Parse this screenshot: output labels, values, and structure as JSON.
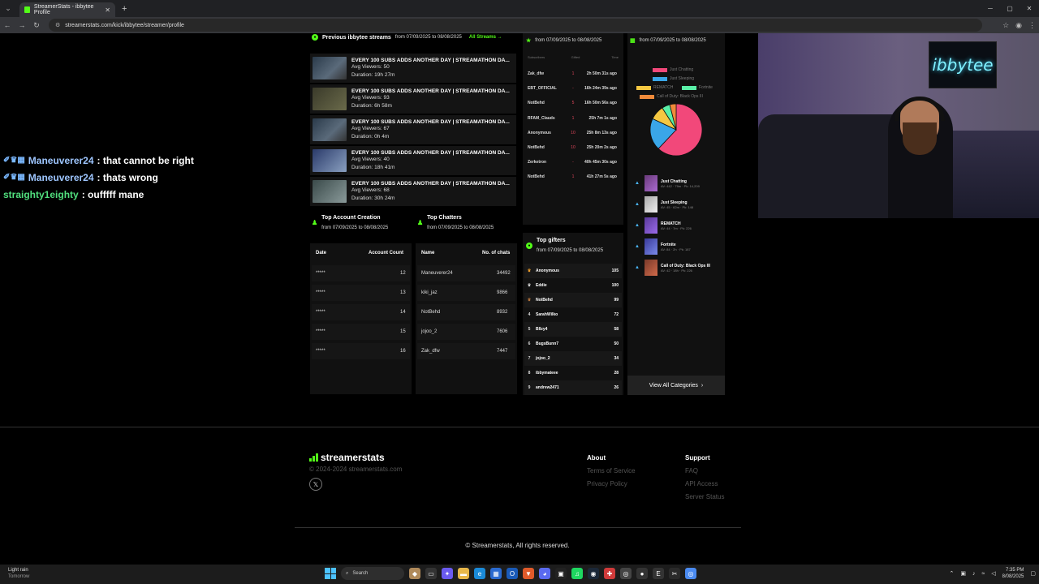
{
  "browser": {
    "tab_title": "StreamerStats - ibbytee Profile",
    "url": "streamerstats.com/kick/ibbytee/streamer/profile"
  },
  "chat": [
    {
      "user": "Maneuverer24",
      "message": ": that cannot be right"
    },
    {
      "user": "Maneuverer24",
      "message": ": thats wrong"
    },
    {
      "user": "straighty1eighty",
      "message": ": oufffff mane"
    }
  ],
  "webcam": {
    "neon_sign": "ibbytee"
  },
  "previous_streams": {
    "title": "Previous ibbytee streams",
    "date_range": "from 07/09/2025 to 08/08/2025",
    "all_link": "All Streams",
    "items": [
      {
        "title": "EVERY 100 SUBS ADDS ANOTHER DAY | STREAMATHON DA...",
        "viewers": "Avg Viewers: 50",
        "duration": "Duration: 19h 27m"
      },
      {
        "title": "EVERY 100 SUBS ADDS ANOTHER DAY | STREAMATHON DA...",
        "viewers": "Avg Viewers: 93",
        "duration": "Duration: 6h 58m"
      },
      {
        "title": "EVERY 100 SUBS ADDS ANOTHER DAY | STREAMATHON DA...",
        "viewers": "Avg Viewers: 67",
        "duration": "Duration: 0h 4m"
      },
      {
        "title": "EVERY 100 SUBS ADDS ANOTHER DAY | STREAMATHON DA...",
        "viewers": "Avg Viewers: 40",
        "duration": "Duration: 18h 41m"
      },
      {
        "title": "EVERY 100 SUBS ADDS ANOTHER DAY | STREAMATHON DA...",
        "viewers": "Avg Viewers: 68",
        "duration": "Duration: 30h 24m"
      }
    ]
  },
  "subs_panel": {
    "date_range": "from 07/09/2025 to 08/08/2025",
    "headers": [
      "Subscribers",
      "Gifted",
      "Time"
    ],
    "rows": [
      {
        "name": "Zak_dfw",
        "gifted": "1",
        "time": "2h 50m 31s ago"
      },
      {
        "name": "EBT_OFFICIAL",
        "gifted": "-",
        "time": "16h 24m 39s ago"
      },
      {
        "name": "NotBehd",
        "gifted": "5",
        "time": "16h 50m 56s ago"
      },
      {
        "name": "RFAM_Clauds",
        "gifted": "1",
        "time": "25h 7m 1s ago"
      },
      {
        "name": "Anonymous",
        "gifted": "10",
        "time": "25h 8m 13s ago"
      },
      {
        "name": "NotBehd",
        "gifted": "10",
        "time": "25h 20m 2s ago"
      },
      {
        "name": "Zerketron",
        "gifted": "-",
        "time": "40h 45m 30s ago"
      },
      {
        "name": "NotBehd",
        "gifted": "1",
        "time": "41h 27m 5s ago"
      }
    ]
  },
  "categories_panel": {
    "date_range": "from 07/09/2025 to 08/08/2025",
    "legend": [
      {
        "label": "Just Chatting",
        "color": "#f2487a"
      },
      {
        "label": "Just Sleeping",
        "color": "#3aa6e8"
      },
      {
        "label": "REMATCH",
        "color": "#f5c842"
      },
      {
        "label": "Fortnite",
        "color": "#5af0a8"
      },
      {
        "label": "Call of Duty: Black Ops III",
        "color": "#f08a3a"
      }
    ],
    "items": [
      {
        "name": "Just Chatting",
        "stats": "AV: 442 · 79m · Pk: 14,209"
      },
      {
        "name": "Just Sleeping",
        "stats": "AV: 45 · 62m · Pk: 148"
      },
      {
        "name": "REMATCH",
        "stats": "AV: 44 · 7m · Pk: 226"
      },
      {
        "name": "Fortnite",
        "stats": "AV: 84 · 2h · Pk: 187"
      },
      {
        "name": "Call of Duty: Black Ops III",
        "stats": "AV: 42 · 18h · Pk: 226"
      }
    ],
    "view_all": "View All Categories"
  },
  "top_account_creation": {
    "title": "Top Account Creation",
    "date_range": "from 07/09/2025 to 08/08/2025",
    "headers": [
      "Date",
      "Account Count"
    ],
    "rows": [
      {
        "date": "*****",
        "count": "12"
      },
      {
        "date": "*****",
        "count": "13"
      },
      {
        "date": "*****",
        "count": "14"
      },
      {
        "date": "*****",
        "count": "15"
      },
      {
        "date": "*****",
        "count": "16"
      }
    ]
  },
  "top_chatters": {
    "title": "Top Chatters",
    "date_range": "from 07/09/2025 to 08/08/2025",
    "headers": [
      "Name",
      "No. of chats"
    ],
    "rows": [
      {
        "name": "Maneuverer24",
        "chats": "34492"
      },
      {
        "name": "kiki_jaz",
        "chats": "9866"
      },
      {
        "name": "NotBehd",
        "chats": "8932"
      },
      {
        "name": "jojoo_2",
        "chats": "7606"
      },
      {
        "name": "Zak_dfw",
        "chats": "7447"
      }
    ]
  },
  "top_gifters": {
    "title": "Top gifters",
    "date_range": "from 07/09/2025 to 08/08/2025",
    "rows": [
      {
        "rank": "",
        "name": "Anonymous",
        "value": "105"
      },
      {
        "rank": "",
        "name": "Eddie",
        "value": "100"
      },
      {
        "rank": "",
        "name": "NotBehd",
        "value": "99"
      },
      {
        "rank": "4",
        "name": "SarahWilko",
        "value": "72"
      },
      {
        "rank": "5",
        "name": "Bllzy4",
        "value": "58"
      },
      {
        "rank": "6",
        "name": "BugsBunn7",
        "value": "50"
      },
      {
        "rank": "7",
        "name": "jojoo_2",
        "value": "34"
      },
      {
        "rank": "8",
        "name": "ibbymateee",
        "value": "28"
      },
      {
        "rank": "9",
        "name": "andrew2471",
        "value": "26"
      }
    ]
  },
  "footer": {
    "logo": "streamerstats",
    "copyright_small": "© 2024-2024 streamerstats.com",
    "about": {
      "heading": "About",
      "links": [
        "Terms of Service",
        "Privacy Policy"
      ]
    },
    "support": {
      "heading": "Support",
      "links": [
        "FAQ",
        "API Access",
        "Server Status"
      ]
    },
    "rights": "© Streamerstats, All rights reserved."
  },
  "taskbar": {
    "weather_title": "Light rain",
    "weather_sub": "Tomorrow",
    "search": "Search",
    "time": "7:35 PM",
    "date": "8/08/2025"
  }
}
